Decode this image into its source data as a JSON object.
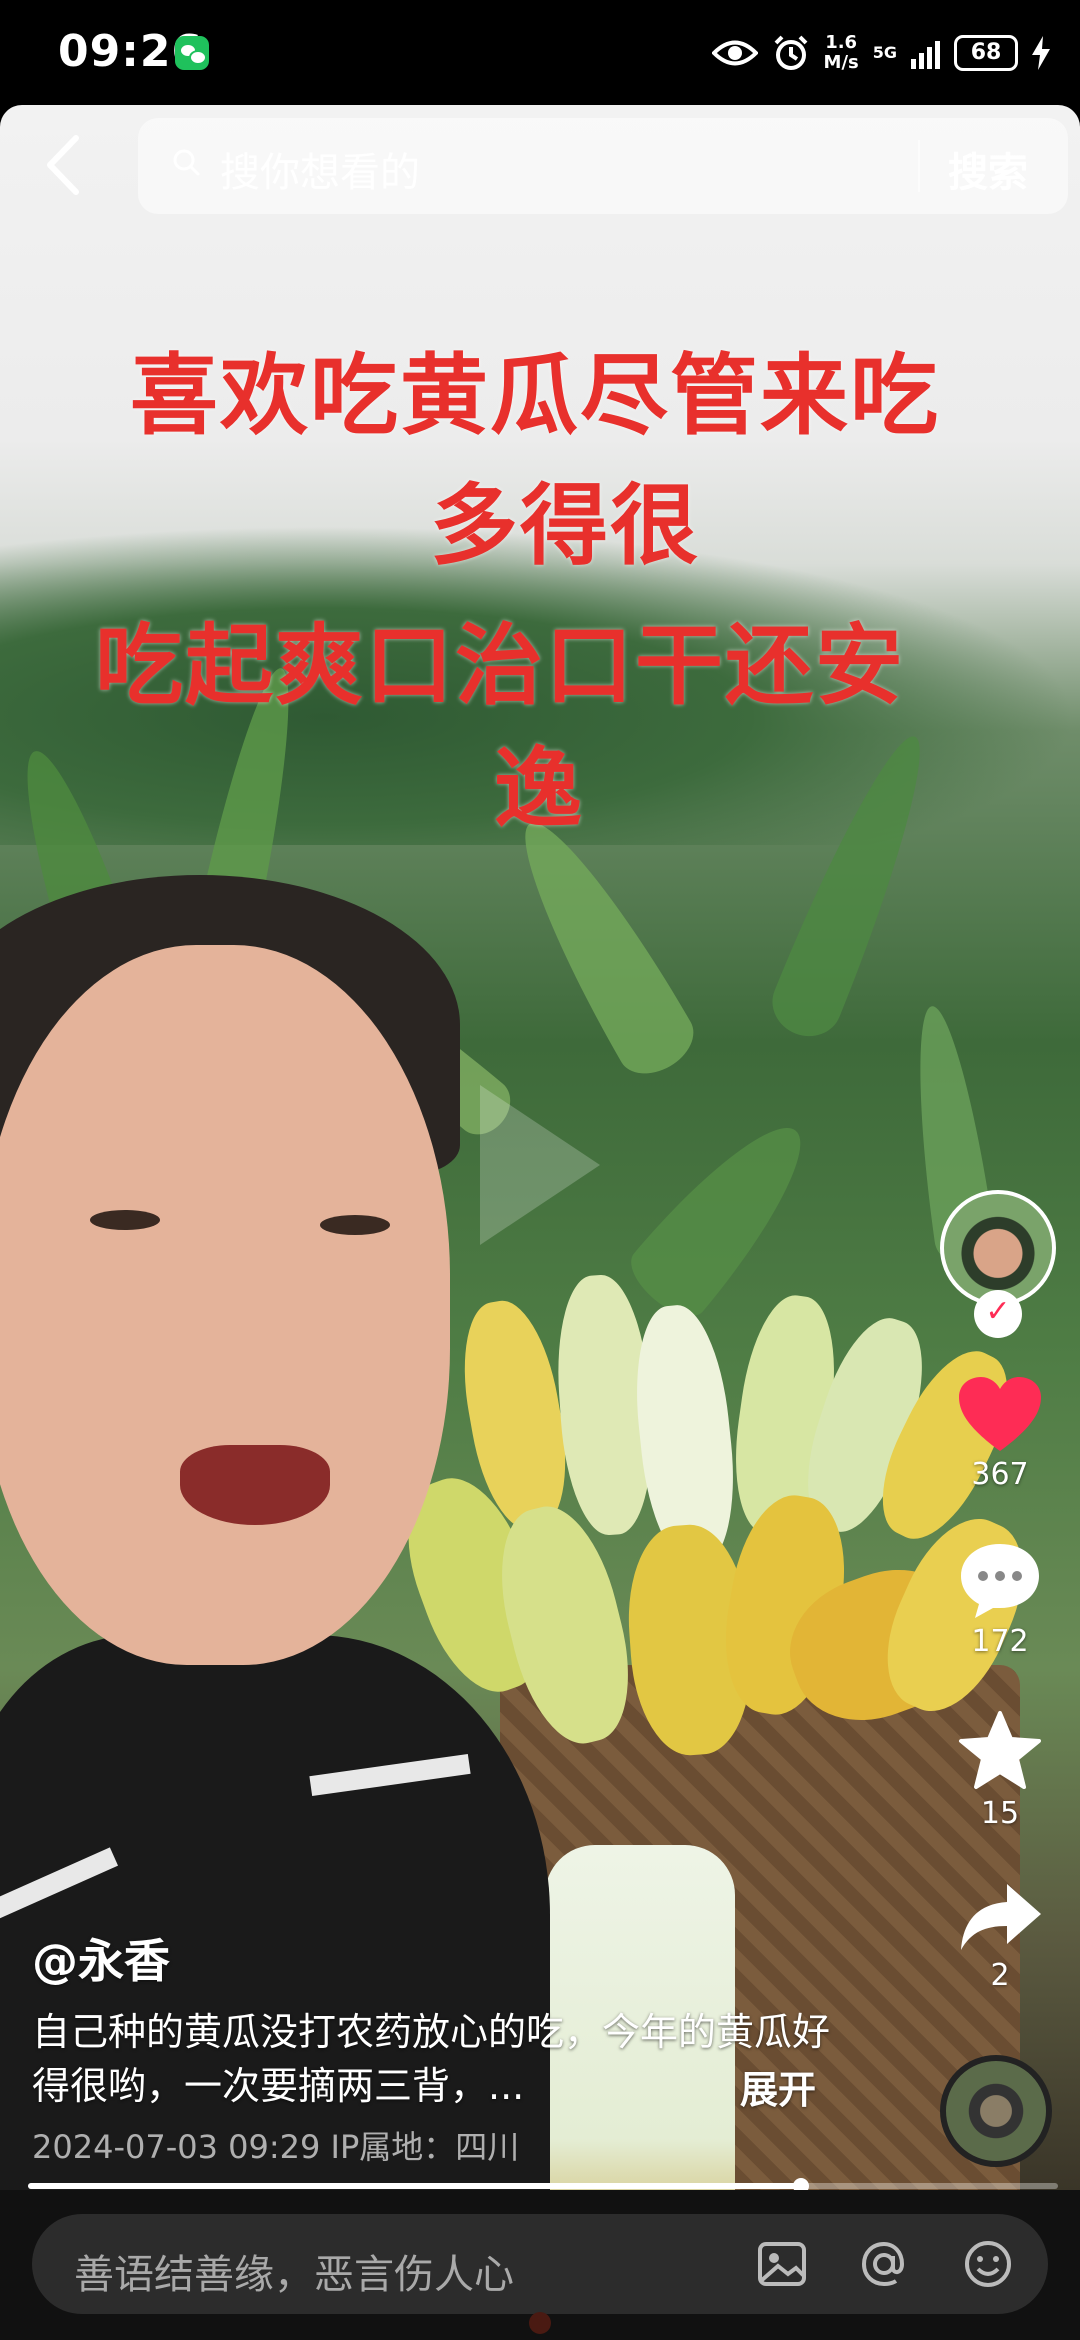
{
  "status_bar": {
    "time": "09:26",
    "net_speed_value": "1.6",
    "net_speed_unit": "M/s",
    "network": "5G",
    "battery": "68"
  },
  "search": {
    "placeholder": "搜你想看的",
    "button_label": "搜索"
  },
  "video_overlay": {
    "line1": "喜欢吃黄瓜尽管来吃",
    "line2": "多得很",
    "line3": "吃起爽口治口干还安",
    "line4": "逸"
  },
  "rail": {
    "like_count": "367",
    "comment_count": "172",
    "favorite_count": "15",
    "share_count": "2",
    "accent": "#fe2c55"
  },
  "caption": {
    "author": "@永香",
    "description": "自己种的黄瓜没打农药放心的吃，今年的黄瓜好得很哟，一次要摘两三背，...",
    "expand_label": "展开",
    "timestamp": "2024-07-03 09:29",
    "location": "IP属地：四川"
  },
  "playback": {
    "progress": 0.75
  },
  "comment_bar": {
    "placeholder": "善语结善缘，恶言伤人心",
    "icons": [
      "image-icon",
      "at-icon",
      "emoji-icon"
    ]
  }
}
